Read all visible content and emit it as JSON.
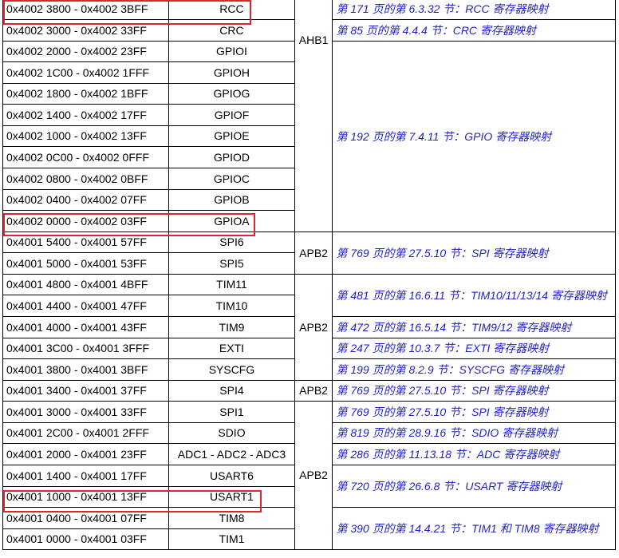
{
  "rows": [
    {
      "address": "0x4002 3800 - 0x4002 3BFF",
      "peripheral": "RCC"
    },
    {
      "address": "0x4002 3000 - 0x4002 33FF",
      "peripheral": "CRC"
    },
    {
      "address": "0x4002 2000 - 0x4002 23FF",
      "peripheral": "GPIOI"
    },
    {
      "address": "0x4002 1C00 - 0x4002 1FFF",
      "peripheral": "GPIOH"
    },
    {
      "address": "0x4002 1800 - 0x4002 1BFF",
      "peripheral": "GPIOG"
    },
    {
      "address": "0x4002 1400 - 0x4002 17FF",
      "peripheral": "GPIOF"
    },
    {
      "address": "0x4002 1000 - 0x4002 13FF",
      "peripheral": "GPIOE"
    },
    {
      "address": "0x4002 0C00 - 0x4002 0FFF",
      "peripheral": "GPIOD"
    },
    {
      "address": "0x4002 0800 - 0x4002 0BFF",
      "peripheral": "GPIOC"
    },
    {
      "address": "0x4002 0400 - 0x4002 07FF",
      "peripheral": "GPIOB"
    },
    {
      "address": "0x4002 0000 - 0x4002 03FF",
      "peripheral": "GPIOA"
    },
    {
      "address": "0x4001 5400 - 0x4001 57FF",
      "peripheral": "SPI6"
    },
    {
      "address": "0x4001 5000 - 0x4001 53FF",
      "peripheral": "SPI5"
    },
    {
      "address": "0x4001 4800 - 0x4001 4BFF",
      "peripheral": "TIM11"
    },
    {
      "address": "0x4001 4400 - 0x4001 47FF",
      "peripheral": "TIM10"
    },
    {
      "address": "0x4001 4000 - 0x4001 43FF",
      "peripheral": "TIM9"
    },
    {
      "address": "0x4001 3C00 - 0x4001 3FFF",
      "peripheral": "EXTI"
    },
    {
      "address": "0x4001 3800 - 0x4001 3BFF",
      "peripheral": "SYSCFG"
    },
    {
      "address": "0x4001 3400 - 0x4001 37FF",
      "peripheral": "SPI4"
    },
    {
      "address": "0x4001 3000 - 0x4001 33FF",
      "peripheral": "SPI1"
    },
    {
      "address": "0x4001 2C00 - 0x4001 2FFF",
      "peripheral": "SDIO"
    },
    {
      "address": "0x4001 2000 - 0x4001 23FF",
      "peripheral": "ADC1 - ADC2 - ADC3"
    },
    {
      "address": "0x4001 1400 - 0x4001 17FF",
      "peripheral": "USART6"
    },
    {
      "address": "0x4001 1000 - 0x4001 13FF",
      "peripheral": "USART1"
    },
    {
      "address": "0x4001 0400 - 0x4001 07FF",
      "peripheral": "TIM8"
    },
    {
      "address": "0x4001 0000 - 0x4001 03FF",
      "peripheral": "TIM1"
    }
  ],
  "buses": [
    "AHB1",
    "APB2",
    "APB2",
    "APB2",
    "APB2"
  ],
  "refs": [
    "第 171 页的第 6.3.32 节：RCC 寄存器映射",
    "第 85 页的第 4.4.4 节：CRC 寄存器映射",
    "第 192 页的第 7.4.11 节：GPIO 寄存器映射",
    "第 769 页的第 27.5.10 节：SPI 寄存器映射",
    "第 481 页的第 16.6.11 节：TIM10/11/13/14 寄存器映射",
    "第 472 页的第 16.5.14 节：TIM9/12 寄存器映射",
    "第 247 页的第 10.3.7 节：EXTI 寄存器映射",
    "第 199 页的第 8.2.9 节：SYSCFG 寄存器映射",
    "第 769 页的第 27.5.10 节：SPI 寄存器映射",
    "第 769 页的第 27.5.10 节：SPI 寄存器映射",
    "第 819 页的第 28.9.16 节：SDIO 寄存器映射",
    "第 286 页的第 11.13.18 节：ADC 寄存器映射",
    "第 720 页的第 26.6.8 节：USART 寄存器映射",
    "第 390 页的第 14.4.21 节：TIM1 和 TIM8 寄存器映射"
  ],
  "highlight_color": "#e0232d",
  "reference_text_color": "#1f1fcc"
}
